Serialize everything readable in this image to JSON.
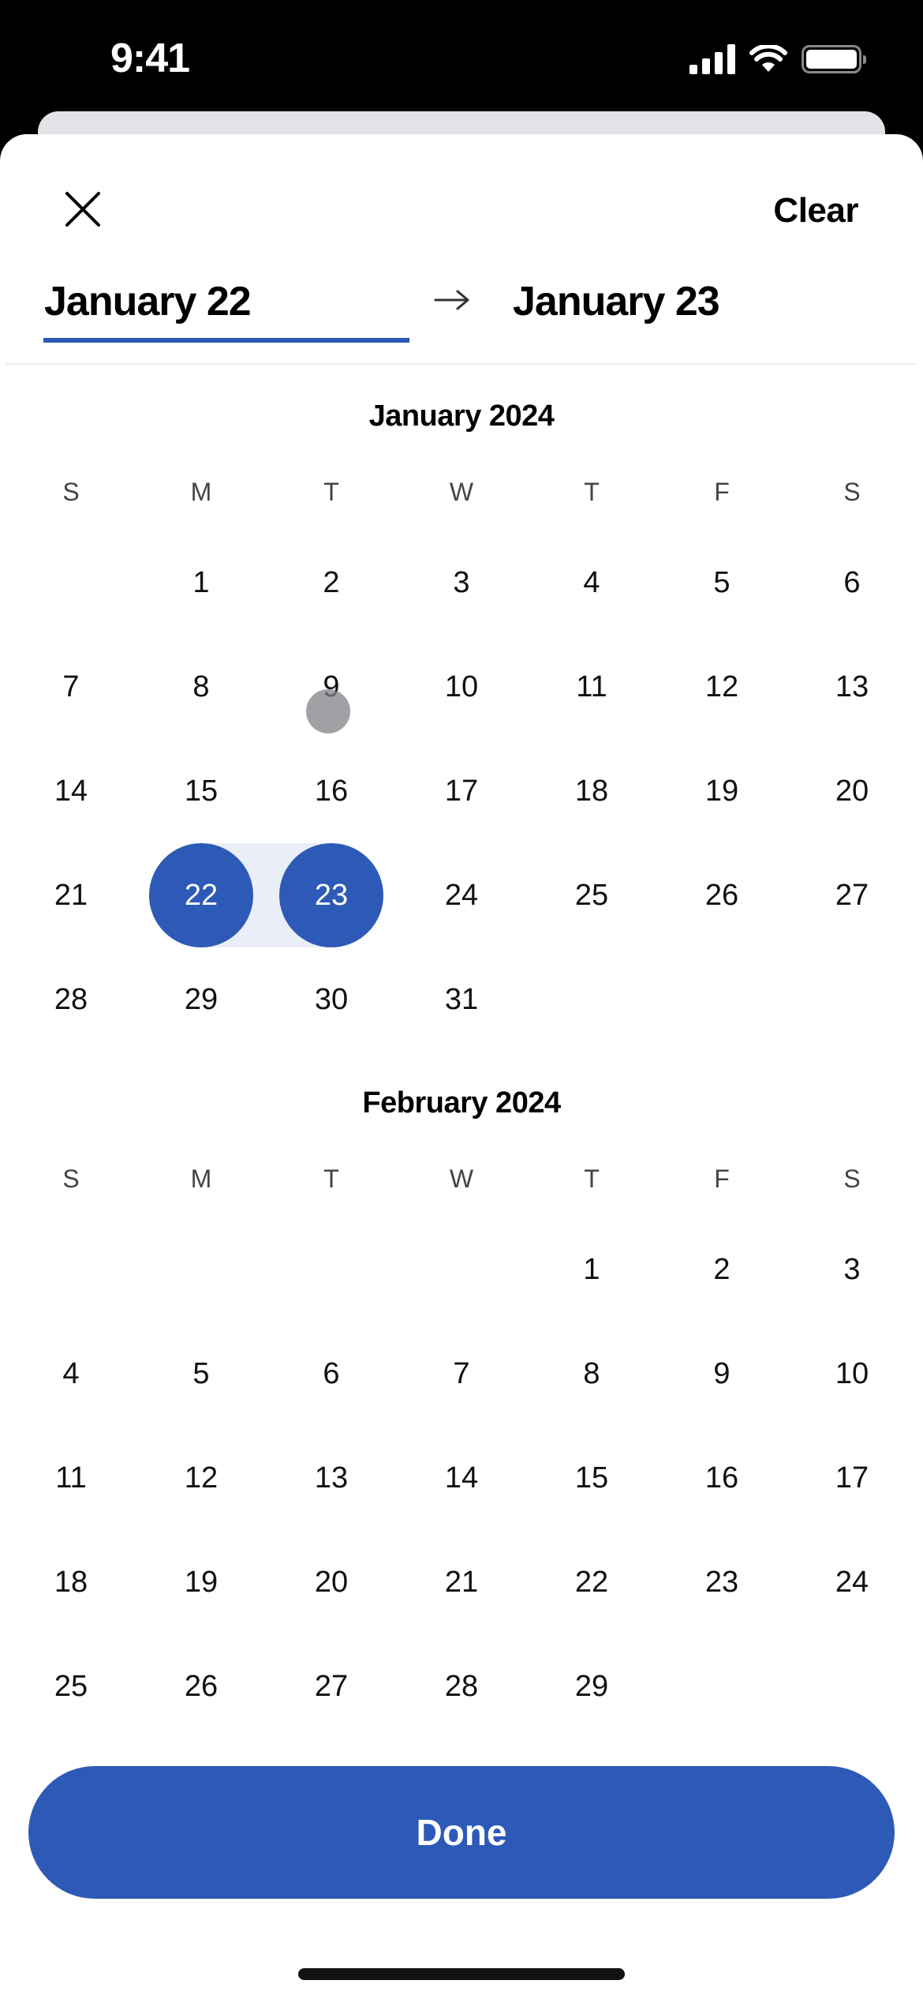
{
  "status_bar": {
    "time": "9:41",
    "icons": [
      "cellular-signal-icon",
      "wifi-icon",
      "battery-icon"
    ]
  },
  "header": {
    "close_icon": "close-icon",
    "clear_label": "Clear"
  },
  "date_range": {
    "start_label": "January 22",
    "end_label": "January 23",
    "arrow_icon": "arrow-right-icon",
    "active_tab": "start"
  },
  "colors": {
    "accent": "#2d5ab6",
    "range_band": "#eaeef9"
  },
  "months": [
    {
      "title": "January 2024",
      "weekdays": [
        "S",
        "M",
        "T",
        "W",
        "T",
        "F",
        "S"
      ],
      "first_weekday": 1,
      "days": 31,
      "selected": [
        22,
        23
      ]
    },
    {
      "title": "February 2024",
      "weekdays": [
        "S",
        "M",
        "T",
        "W",
        "T",
        "F",
        "S"
      ],
      "first_weekday": 4,
      "days": 29,
      "selected": []
    }
  ],
  "footer": {
    "done_label": "Done"
  }
}
